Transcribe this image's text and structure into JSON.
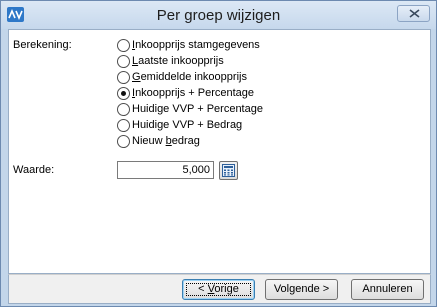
{
  "window": {
    "title": "Per groep wijzigen"
  },
  "form": {
    "berekening_label": "Berekening:",
    "waarde_label": "Waarde:",
    "waarde_value": "5,000",
    "options": [
      {
        "before": "",
        "mnemonic": "I",
        "after": "nkoopprijs stamgegevens",
        "selected": false
      },
      {
        "before": "",
        "mnemonic": "L",
        "after": "aatste inkoopprijs",
        "selected": false
      },
      {
        "before": "",
        "mnemonic": "G",
        "after": "emiddelde inkoopprijs",
        "selected": false
      },
      {
        "before": "",
        "mnemonic": "I",
        "after": "nkoopprijs + Percentage",
        "selected": true
      },
      {
        "before": "Huidige VVP + Percentage",
        "mnemonic": "",
        "after": "",
        "selected": false
      },
      {
        "before": "Huidige VVP + Bedrag",
        "mnemonic": "",
        "after": "",
        "selected": false
      },
      {
        "before": "Nieuw ",
        "mnemonic": "b",
        "after": "edrag",
        "selected": false
      }
    ]
  },
  "buttons": {
    "prev": {
      "before": "< ",
      "mnemonic": "V",
      "after": "orige"
    },
    "next": {
      "before": "Volgende >",
      "mnemonic": "",
      "after": ""
    },
    "cancel": {
      "before": "Annuleren",
      "mnemonic": "",
      "after": ""
    }
  },
  "icons": {
    "app": "app-logo-icon",
    "close": "close-icon",
    "calculator": "calculator-icon"
  }
}
